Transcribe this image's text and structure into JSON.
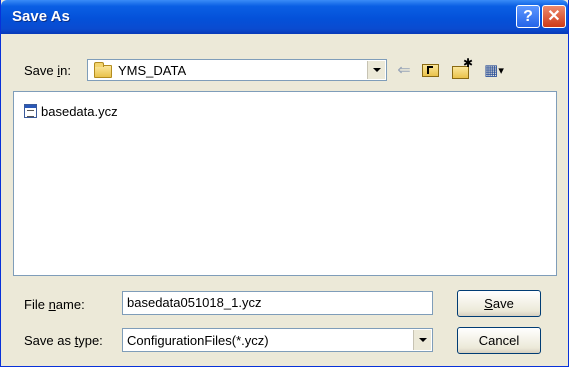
{
  "window": {
    "title": "Save As"
  },
  "title_buttons": {
    "help": "?",
    "close": "✕"
  },
  "save_in": {
    "label_pre": "Save ",
    "label_hot": "i",
    "label_post": "n:",
    "value": "YMS_DATA"
  },
  "toolbar": {
    "icons": [
      "back-arrow-icon",
      "up-folder-icon",
      "new-folder-icon",
      "view-menu-icon"
    ],
    "back_glyph": "⇐",
    "view_glyph": "▦",
    "view_arrow": "▾"
  },
  "files": [
    {
      "name": "basedata.ycz",
      "icon": "file-icon"
    }
  ],
  "file_name": {
    "label_pre": "File ",
    "label_hot": "n",
    "label_post": "ame:",
    "value": "basedata051018_1.ycz"
  },
  "save_as_type": {
    "label_pre": "Save as ",
    "label_hot": "t",
    "label_post": "ype:",
    "value": "ConfigurationFiles(*.ycz)"
  },
  "buttons": {
    "save_hot": "S",
    "save_rest": "ave",
    "cancel": "Cancel"
  },
  "colors": {
    "title_bar": "#0a5fe4",
    "dialog_bg": "#ece9d8",
    "close_red": "#cf3a17"
  }
}
